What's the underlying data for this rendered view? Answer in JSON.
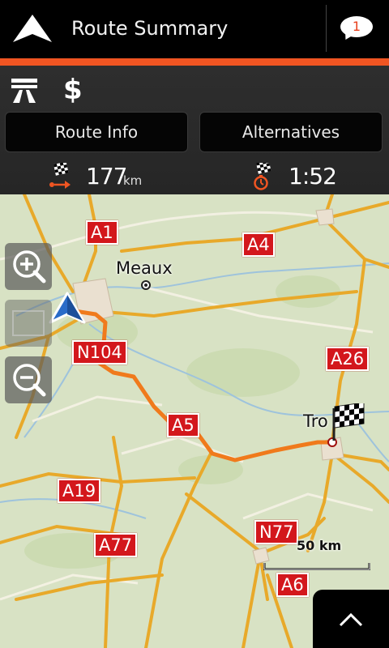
{
  "header": {
    "title": "Route Summary",
    "message_count": "1",
    "icons": {
      "nav": "navigation-arrow-icon",
      "messages": "message-bubble-icon"
    }
  },
  "panel": {
    "icons": {
      "motorway": "motorway-icon",
      "toll": "toll-dollar-icon"
    },
    "toll_symbol": "$",
    "tabs": {
      "route_info": "Route Info",
      "alternatives": "Alternatives"
    },
    "distance": {
      "value": "177",
      "unit": "km",
      "icon": "checkered-flag-distance-icon"
    },
    "duration": {
      "value": "1:52",
      "icon": "checkered-flag-timer-icon"
    }
  },
  "map": {
    "cities": {
      "meaux": "Meaux",
      "destination": "Tro"
    },
    "roads": {
      "a1": "A1",
      "a4": "A4",
      "n104": "N104",
      "a26": "A26",
      "a5": "A5",
      "a19": "A19",
      "a77": "A77",
      "n77": "N77",
      "a6": "A6"
    },
    "scale": "50 km",
    "controls": {
      "zoom_in": "zoom-in-icon",
      "zoom_out": "zoom-out-icon",
      "collapse": "chevron-up-icon"
    }
  },
  "colors": {
    "accent": "#f05522",
    "route": "#f07a1c",
    "road_label": "#d3171c",
    "map_bg": "#d8e2c4"
  }
}
